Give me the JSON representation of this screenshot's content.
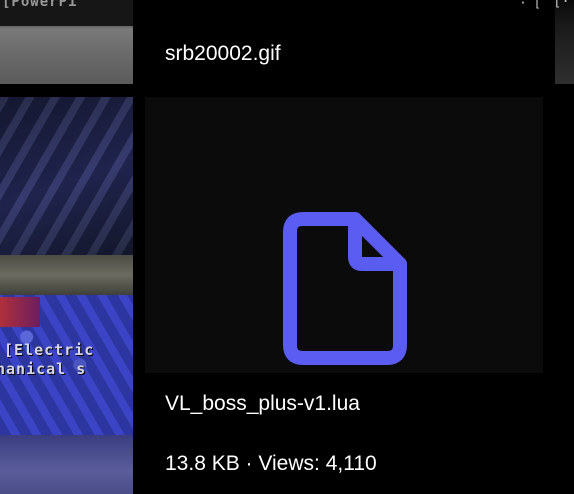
{
  "colors": {
    "background": "#000000",
    "preview_bg": "#0b0b0b",
    "file_icon": "#5a5cf2",
    "text": "#ffffff"
  },
  "left_column": {
    "top_thumb_caption": "[PowerPi",
    "main_thumb_line1": "[Electric",
    "main_thumb_line2": "hanical s"
  },
  "top_card": {
    "corner_text": "· [",
    "filename": "srb20002.gif"
  },
  "right_column": {
    "corner_text": "[·"
  },
  "main_card": {
    "icon": "file-icon",
    "filename": "VL_boss_plus-v1.lua",
    "meta": "13.8 KB · Views: 4,110"
  }
}
